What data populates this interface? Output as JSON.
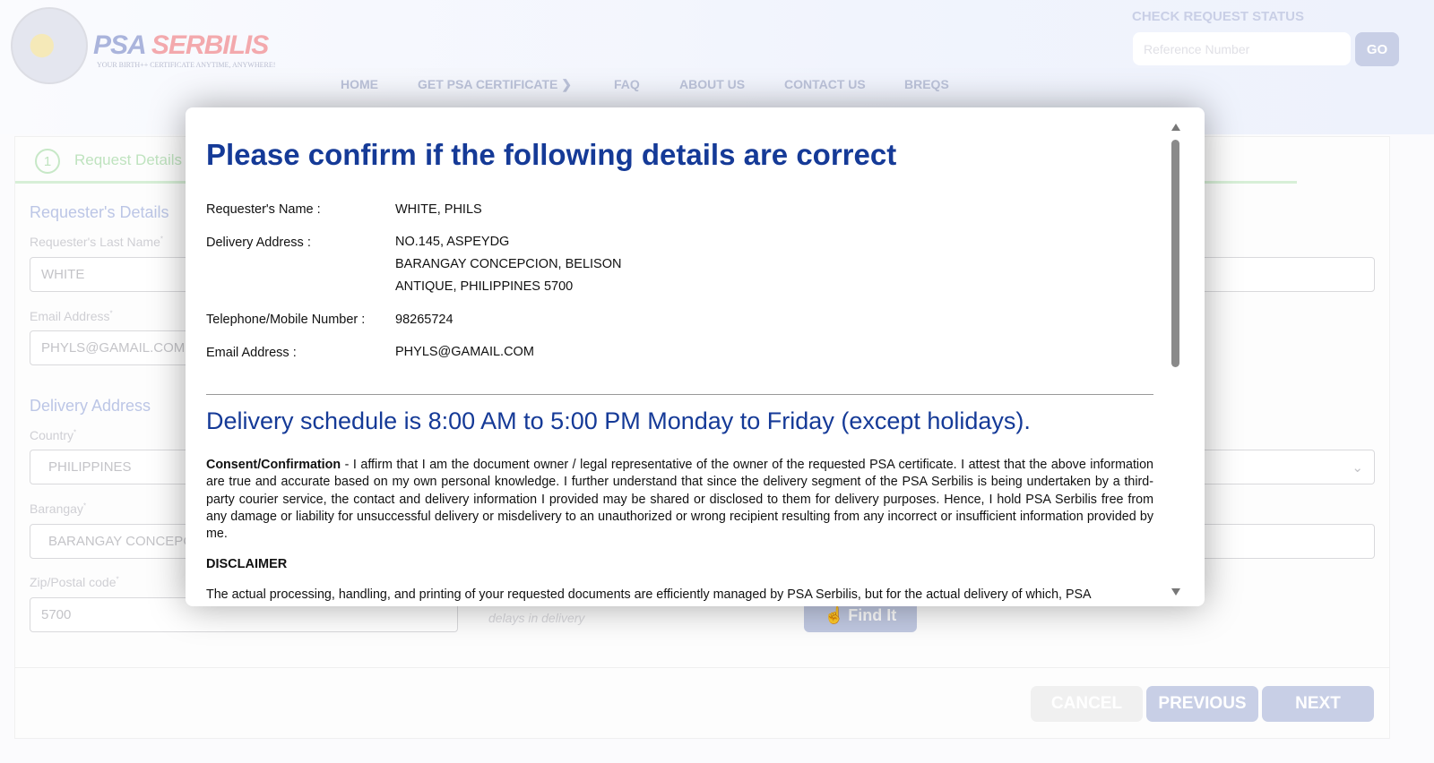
{
  "header": {
    "logo_text": "PSA SERBILIS",
    "logo_psa": "PSA",
    "logo_serbilis": "SERBILIS",
    "tagline": "YOUR BIRTH++ CERTIFICATE ANYTIME, ANYWHERE!",
    "seal_text": "PHILIPPINE STATISTICS AUTHORITY",
    "nav": [
      "HOME",
      "GET PSA CERTIFICATE",
      "FAQ",
      "ABOUT US",
      "CONTACT US",
      "BREQS"
    ],
    "check_status": {
      "title": "CHECK REQUEST STATUS",
      "placeholder": "Reference Number",
      "go_label": "GO"
    }
  },
  "form": {
    "step": {
      "number": "1",
      "label": "Request Details"
    },
    "requester_section": "Requester's Details",
    "last_name_label": "Requester's Last Name",
    "last_name_value": "WHITE",
    "email_label": "Email Address",
    "email_value": "PHYLS@GAMAIL.COM",
    "delivery_section": "Delivery Address",
    "country_label": "Country",
    "country_value": "PHILIPPINES",
    "barangay_label": "Barangay",
    "barangay_value": "BARANGAY CONCEPCION",
    "zip_label": "Zip/Postal code",
    "zip_value": "5700",
    "hint": "delays in delivery",
    "find_label": "Find It",
    "cancel_label": "CANCEL",
    "previous_label": "PREVIOUS",
    "next_label": "NEXT"
  },
  "modal": {
    "title": "Please confirm if the following details are correct",
    "rows": [
      {
        "label": "Requester's Name :",
        "value": [
          "WHITE, PHILS"
        ]
      },
      {
        "label": "Delivery Address :",
        "value": [
          "NO.145, ASPEYDG",
          "BARANGAY CONCEPCION, BELISON",
          "ANTIQUE, PHILIPPINES 5700"
        ]
      },
      {
        "label": "Telephone/Mobile Number :",
        "value": [
          "98265724"
        ]
      },
      {
        "label": "Email Address :",
        "value": [
          "PHYLS@GAMAIL.COM"
        ]
      }
    ],
    "schedule": "Delivery schedule is 8:00 AM to 5:00 PM Monday to Friday (except holidays).",
    "consent_title": "Consent/Confirmation",
    "consent_text": " - I affirm that I am the document owner / legal representative of the owner of the requested PSA certificate. I attest that the above information are true and accurate based on my own personal knowledge. I further understand that since the delivery segment of the PSA Serbilis is being undertaken by a third-party courier service, the contact and delivery information I provided may be shared or disclosed to them for delivery purposes. Hence, I hold PSA Serbilis free from any damage or liability for unsuccessful delivery or misdelivery to an unauthorized or wrong recipient resulting from any incorrect or insufficient information provided by me.",
    "disclaimer_title": "DISCLAIMER",
    "disclaimer_text": "The actual processing, handling, and printing of your requested documents are efficiently managed by PSA Serbilis, but for the actual delivery of which, PSA"
  },
  "colors": {
    "title_blue": "#153a97",
    "step_green": "#bfe3bf",
    "button_blue": "#c8cfe6"
  }
}
